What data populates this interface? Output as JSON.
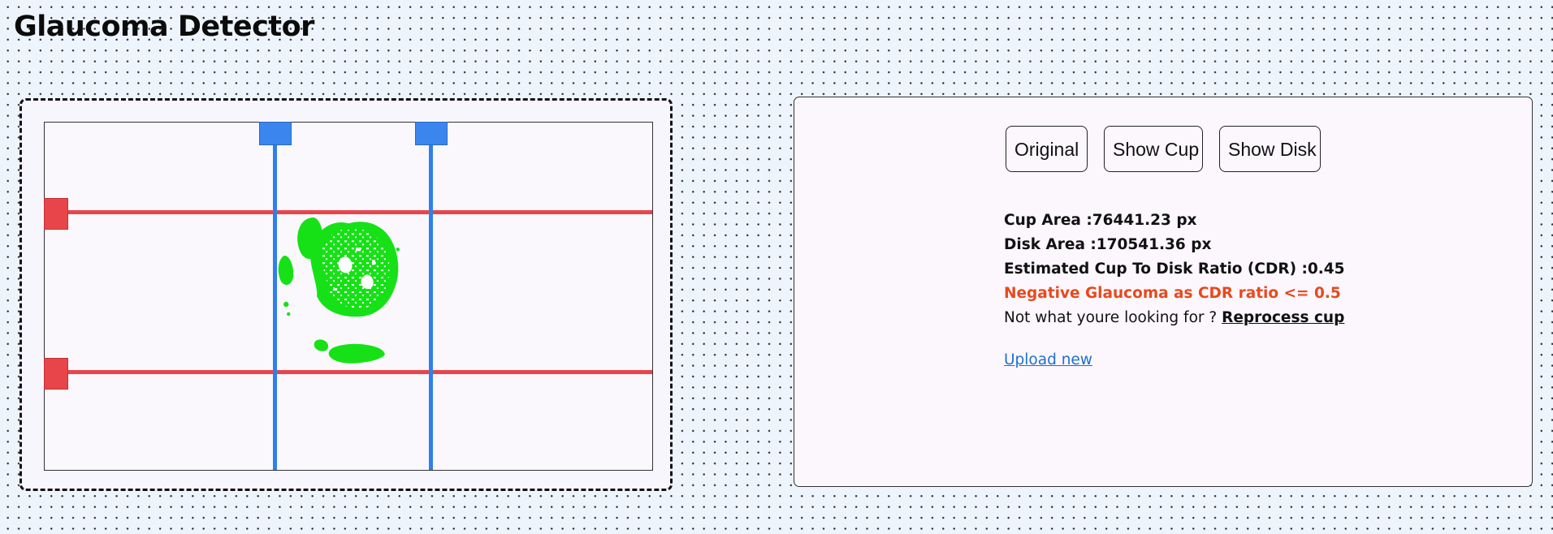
{
  "app": {
    "title": "Glaucoma Detector"
  },
  "colors": {
    "page_background": "#eef4fc",
    "horizontal_guide": "#e8454a",
    "vertical_guide": "#2f80e8",
    "segmentation_mask": "#16e116",
    "verdict_text": "#e8491d",
    "link": "#1f6fd0"
  },
  "editor": {
    "horizontal_guides": 2,
    "vertical_guides": 2,
    "mask_color": "green"
  },
  "results": {
    "view_buttons": [
      {
        "label": "Original"
      },
      {
        "label": "Show Cup"
      },
      {
        "label": "Show Disk"
      }
    ],
    "cup_area": "Cup Area :76441.23 px",
    "disk_area": "Disk Area :170541.36 px",
    "cdr": "Estimated Cup To Disk Ratio (CDR) :0.45",
    "verdict": "Negative Glaucoma as CDR ratio <= 0.5",
    "reprocess_prompt": "Not what youre looking for ?",
    "reprocess_link": "Reprocess cup",
    "upload_link": "Upload new"
  }
}
